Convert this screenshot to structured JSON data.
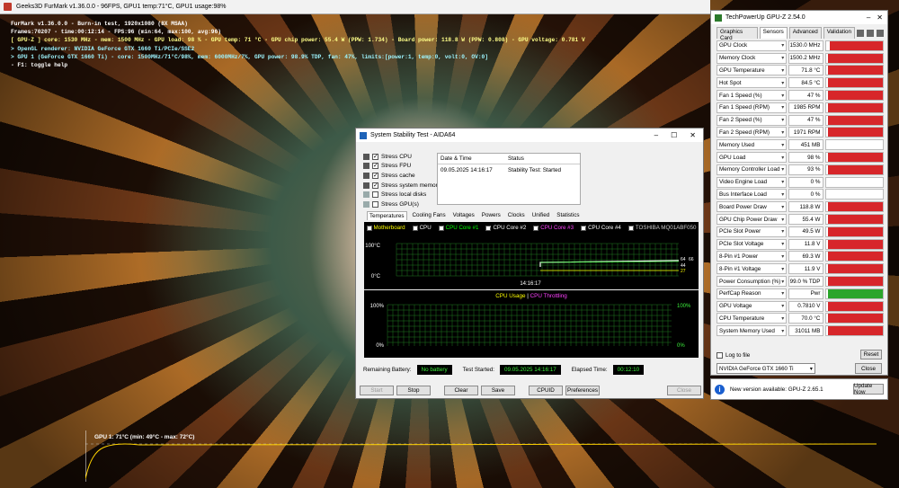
{
  "furmark": {
    "window_title": "Geeks3D FurMark v1.36.0.0 - 96FPS, GPU1 temp:71°C, GPU1 usage:98%",
    "info_lines": [
      {
        "text": "FurMark v1.36.0.0 - Burn-in test, 1920x1080 (8X MSAA)",
        "color": "w"
      },
      {
        "text": "Frames:70207 - time:00:12:14 - FPS:96 (min:64, max:100, avg:96)",
        "color": "w"
      },
      {
        "text": "[ GPU-Z ] core: 1530 MHz - mem: 1500 MHz - GPU load: 98 % - GPU temp: 71 °C - GPU chip power: 55.4 W (PPW: 1.734) - Board power: 118.8 W (PPW: 0.808) - GPU voltage: 0.781 V",
        "color": "y"
      },
      {
        "text": "> OpenGL renderer: NVIDIA GeForce GTX 1660 Ti/PCIe/SSE2",
        "color": "c"
      },
      {
        "text": "> GPU 1 (GeForce GTX 1660 Ti) - core: 1500MHz/71°C/98%, mem: 6000MHz/7%, GPU power: 98.9% TDP, fan: 47%, limits:[power:1, temp:0, volt:0, OV:0]",
        "color": "c"
      },
      {
        "text": "- F1: toggle help",
        "color": "w"
      }
    ],
    "graph_label": "GPU 1: 71°C (min: 49°C - max: 72°C)"
  },
  "gpuz": {
    "title": "TechPowerUp GPU-Z 2.54.0",
    "tabs": [
      "Graphics Card",
      "Sensors",
      "Advanced",
      "Validation"
    ],
    "sensors": [
      {
        "name": "GPU Clock",
        "value": "1530.0 MHz",
        "fill": 0.95
      },
      {
        "name": "Memory Clock",
        "value": "1500.2 MHz",
        "fill": 0.98
      },
      {
        "name": "GPU Temperature",
        "value": "71.8 °C",
        "fill": 0.98
      },
      {
        "name": "Hot Spot",
        "value": "84.5 °C",
        "fill": 0.98
      },
      {
        "name": "Fan 1 Speed (%)",
        "value": "47 %",
        "fill": 0.98
      },
      {
        "name": "Fan 1 Speed (RPM)",
        "value": "1985 RPM",
        "fill": 0.98
      },
      {
        "name": "Fan 2 Speed (%)",
        "value": "47 %",
        "fill": 0.98
      },
      {
        "name": "Fan 2 Speed (RPM)",
        "value": "1971 RPM",
        "fill": 0.98
      },
      {
        "name": "Memory Used",
        "value": "451 MB",
        "fill": 0.0
      },
      {
        "name": "GPU Load",
        "value": "98 %",
        "fill": 0.98
      },
      {
        "name": "Memory Controller Load",
        "value": "93 %",
        "fill": 0.98
      },
      {
        "name": "Video Engine Load",
        "value": "0 %",
        "fill": 0.0
      },
      {
        "name": "Bus Interface Load",
        "value": "0 %",
        "fill": 0.0
      },
      {
        "name": "Board Power Draw",
        "value": "118.8 W",
        "fill": 0.98
      },
      {
        "name": "GPU Chip Power Draw",
        "value": "55.4 W",
        "fill": 0.98
      },
      {
        "name": "PCIe Slot Power",
        "value": "49.5 W",
        "fill": 0.98
      },
      {
        "name": "PCIe Slot Voltage",
        "value": "11.8 V",
        "fill": 0.98
      },
      {
        "name": "8-Pin #1 Power",
        "value": "69.3 W",
        "fill": 0.98
      },
      {
        "name": "8-Pin #1 Voltage",
        "value": "11.9 V",
        "fill": 0.98
      },
      {
        "name": "Power Consumption (%)",
        "value": "99.0 % TDP",
        "fill": 0.98
      },
      {
        "name": "PerfCap Reason",
        "value": "Pwr",
        "fill": 0.98,
        "green": true
      },
      {
        "name": "GPU Voltage",
        "value": "0.7810 V",
        "fill": 0.98
      },
      {
        "name": "CPU Temperature",
        "value": "70.0 °C",
        "fill": 0.98
      },
      {
        "name": "System Memory Used",
        "value": "31011 MB",
        "fill": 0.98
      }
    ],
    "log_label": "Log to file",
    "reset_label": "Reset",
    "gpu_select": "NVIDIA GeForce GTX 1660 Ti",
    "close_label": "Close",
    "update_text": "New version available: GPU-Z 2.65.1",
    "update_button": "Update Now"
  },
  "aida": {
    "title": "System Stability Test - AIDA64",
    "stress_items": [
      {
        "label": "Stress CPU",
        "checked": true
      },
      {
        "label": "Stress FPU",
        "checked": true
      },
      {
        "label": "Stress cache",
        "checked": true
      },
      {
        "label": "Stress system memory",
        "checked": true
      },
      {
        "label": "Stress local disks",
        "checked": false
      },
      {
        "label": "Stress GPU(s)",
        "checked": false
      }
    ],
    "status_header": {
      "date": "Date & Time",
      "status": "Status"
    },
    "status_row": {
      "date": "09.05.2025 14:16:17",
      "status": "Stability Test: Started"
    },
    "tabs": [
      "Temperatures",
      "Cooling Fans",
      "Voltages",
      "Powers",
      "Clocks",
      "Unified",
      "Statistics"
    ],
    "legend": [
      "Motherboard",
      "CPU",
      "CPU Core #1",
      "CPU Core #2",
      "CPU Core #3",
      "CPU Core #4",
      "TOSHIBA MQ01ABF050"
    ],
    "temp_chart": {
      "ymax": "100°C",
      "ymin": "0°C",
      "xlabel": "14:16:17",
      "right_vals": [
        "64",
        "66",
        "44",
        "27"
      ]
    },
    "usage_chart": {
      "title_a": "CPU Usage",
      "sep": "|",
      "title_b": "CPU Throttling",
      "ymax_l": "100%",
      "ymin_l": "0%",
      "ymax_r": "100%",
      "ymin_r": "0%"
    },
    "battery_label": "Remaining Battery:",
    "battery_value": "No battery",
    "started_label": "Test Started:",
    "started_value": "09.05.2025 14:16:17",
    "elapsed_label": "Elapsed Time:",
    "elapsed_value": "00:12:10",
    "buttons": {
      "start": "Start",
      "stop": "Stop",
      "clear": "Clear",
      "save": "Save",
      "cpuid": "CPUID",
      "prefs": "Preferences",
      "close": "Close"
    }
  }
}
